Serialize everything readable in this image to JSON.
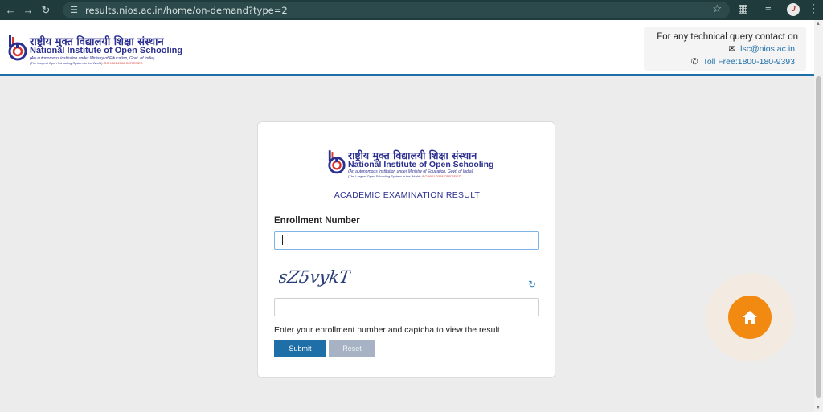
{
  "browser": {
    "url": "results.nios.ac.in/home/on-demand?type=2",
    "profile_initial": "J"
  },
  "header": {
    "logo": {
      "hindi": "राष्ट्रीय मुक्त विद्यालयी शिक्षा संस्थान",
      "english_prefix": "National Institute of ",
      "english_bold": "Open Schooling",
      "sub1": "(An autonomous institution under Ministry of Education, Govt. of India)",
      "sub2": "(The Largest Open Schooling System in the World)",
      "iso": "ISO 9001:2008 CERTIFIED"
    },
    "contact": {
      "title": "For any technical query contact on",
      "email": "lsc@nios.ac.in",
      "phone": "Toll Free:1800-180-9393"
    }
  },
  "card": {
    "title": "ACADEMIC EXAMINATION RESULT",
    "enrollment_label": "Enrollment Number",
    "enrollment_value": "",
    "captcha_text": "sZ5vykT",
    "captcha_value": "",
    "helper_text": "Enter your enrollment number and captcha to view the result",
    "submit_label": "Submit",
    "reset_label": "Reset"
  },
  "colors": {
    "primary": "#1e6ea8",
    "brand": "#2b2f8f",
    "home_button": "#f28a12",
    "chrome_bg": "#1f3b3c"
  },
  "icons": {
    "back": "arrow-left-icon",
    "forward": "arrow-right-icon",
    "reload": "reload-icon",
    "site_info": "tune-icon",
    "bookmark": "star-icon",
    "extensions": "puzzle-icon",
    "email": "envelope-icon",
    "phone": "phone-icon",
    "refresh": "refresh-icon",
    "home": "home-icon"
  }
}
